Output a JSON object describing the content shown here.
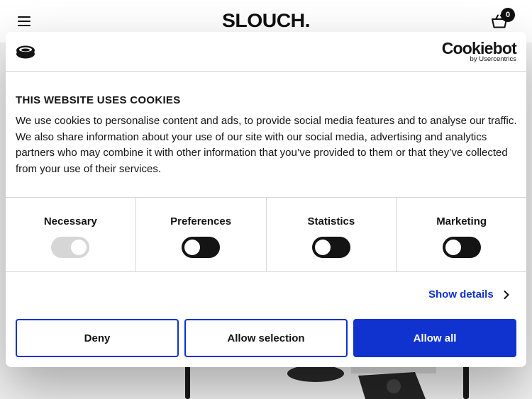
{
  "site": {
    "logo_text": "SLOUCH.",
    "basket_count": "0",
    "icons": [
      "hamburger-menu-icon",
      "basket-icon"
    ]
  },
  "cookie_dialog": {
    "brand_name": "Cookiebot",
    "brand_sub": "by Usercentrics",
    "title": "THIS WEBSITE USES COOKIES",
    "body": "We use cookies to personalise content and ads, to provide social media features and to analyse our traffic. We also share information about your use of our site with our social media, advertising and analytics partners who may combine it with other information that you’ve provided to them or that they’ve collected from your use of their services.",
    "toggles": [
      {
        "label": "Necessary",
        "state": "on-disabled"
      },
      {
        "label": "Preferences",
        "state": "off"
      },
      {
        "label": "Statistics",
        "state": "off"
      },
      {
        "label": "Marketing",
        "state": "off"
      }
    ],
    "show_details_label": "Show details",
    "buttons": {
      "deny": "Deny",
      "allow_selection": "Allow selection",
      "allow_all": "Allow all"
    },
    "colors": {
      "accent": "#1032cf",
      "toggle_off": "#141414",
      "toggle_disabled": "#d6d6d6"
    }
  }
}
